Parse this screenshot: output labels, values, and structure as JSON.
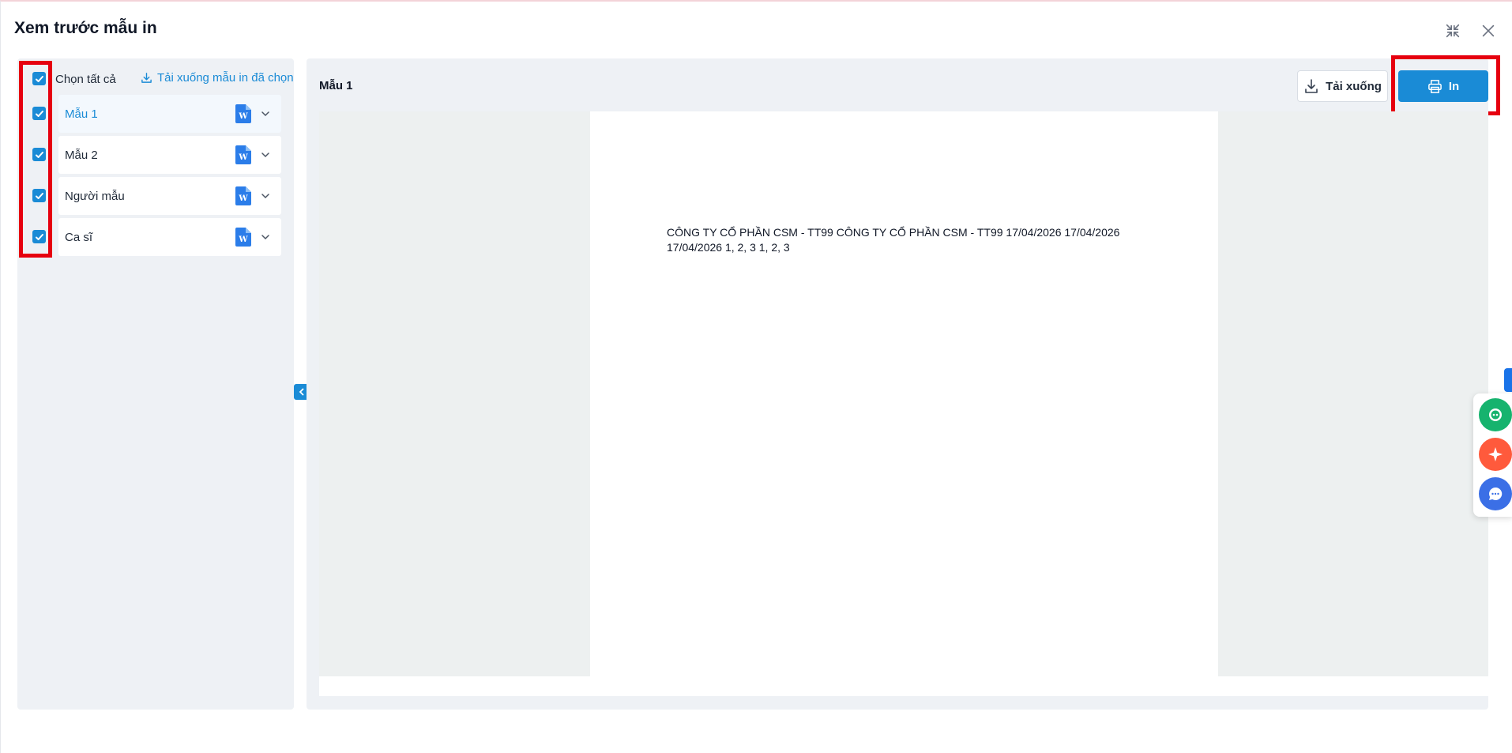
{
  "dialog": {
    "title": "Xem trước mẫu in"
  },
  "sidebar": {
    "select_all_label": "Chọn tất cả",
    "download_selected_label": "Tải xuống mẫu in đã chọn",
    "items": [
      {
        "label": "Mẫu 1",
        "checked": true,
        "active": true
      },
      {
        "label": "Mẫu 2",
        "checked": true,
        "active": false
      },
      {
        "label": "Người mẫu",
        "checked": true,
        "active": false
      },
      {
        "label": "Ca sĩ",
        "checked": true,
        "active": false
      }
    ]
  },
  "preview": {
    "title": "Mẫu 1",
    "download_label": "Tải xuống",
    "print_label": "In",
    "document_text": "CÔNG TY CỔ PHẦN CSM - TT99 CÔNG TY CỔ PHẦN CSM - TT99 17/04/2026 17/04/2026 17/04/2026 1, 2, 3 1, 2, 3"
  },
  "colors": {
    "accent": "#1a8bd6",
    "highlight_box": "#e6000f",
    "panel_bg": "#eef1f5",
    "fab_green": "#16b36e",
    "fab_orange": "#ff5a3c",
    "fab_blue": "#3b6fe6"
  },
  "icons": {
    "minimize": "collapse-arrows-icon",
    "close": "close-icon",
    "download": "download-icon",
    "print": "printer-icon",
    "file": "word-file-icon",
    "expand": "chevron-down-icon",
    "sidebar_toggle": "chevron-left-icon",
    "chatbot": "bot-icon",
    "ai": "sparkle-icon",
    "chat": "chat-bubble-icon"
  }
}
